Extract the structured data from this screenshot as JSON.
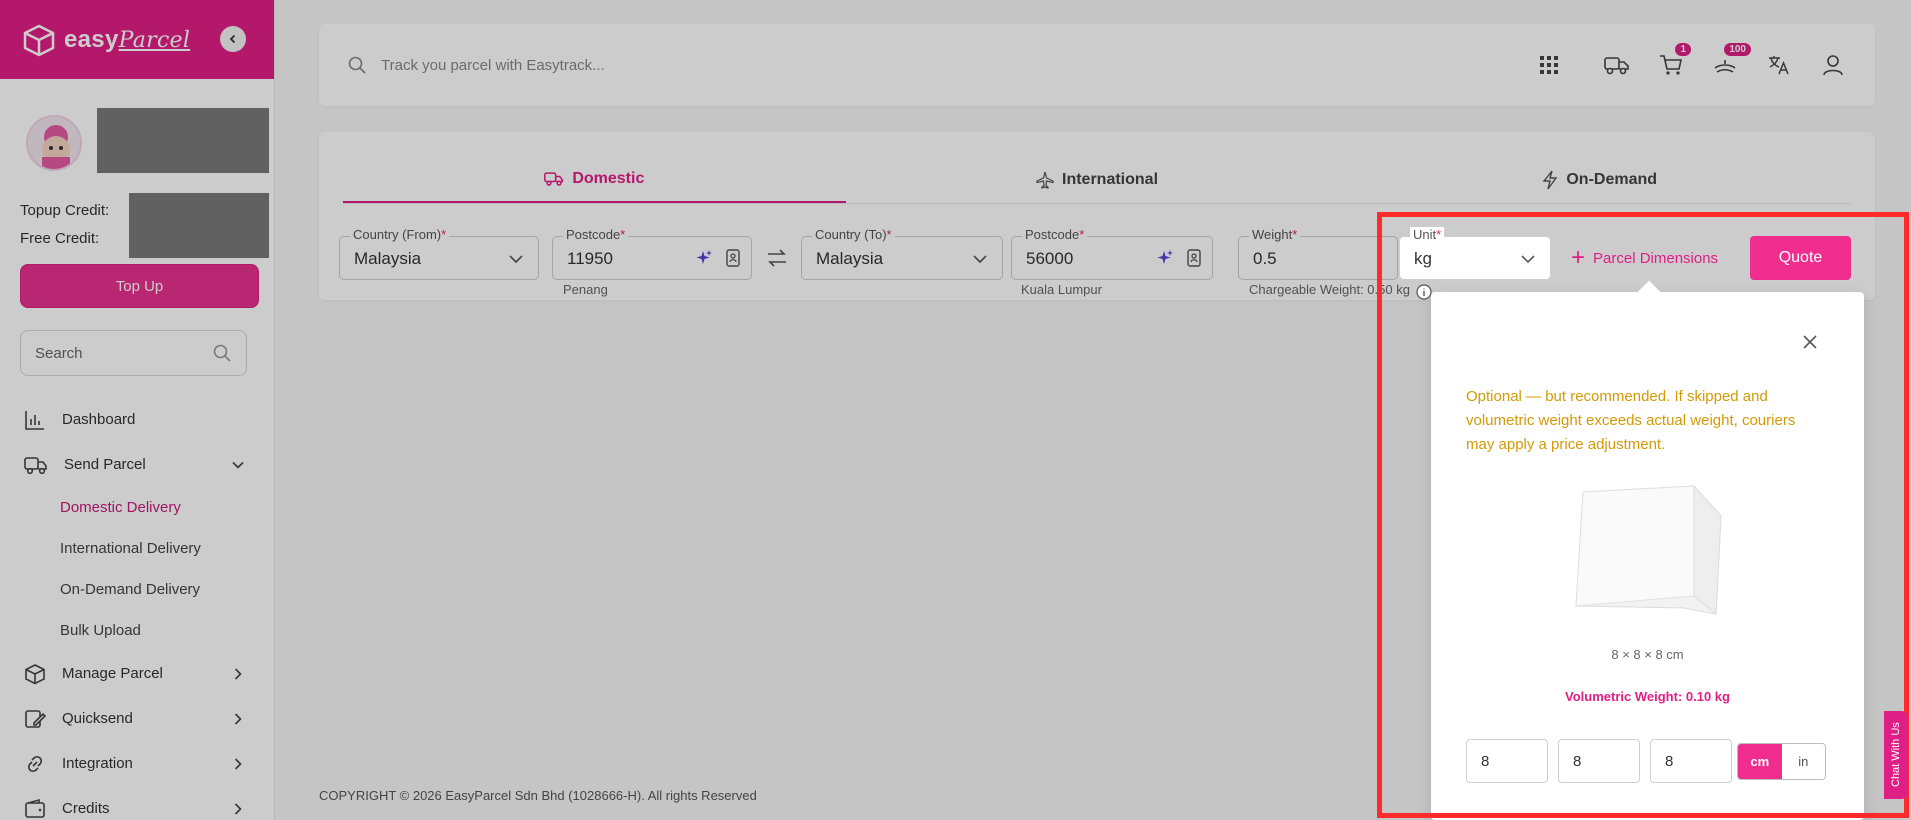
{
  "brand": {
    "name": "easy",
    "name_italic": "Parcel"
  },
  "profile": {
    "topup_credit_label": "Topup Credit:",
    "free_credit_label": "Free Credit:",
    "topup_button": "Top Up"
  },
  "sidebar": {
    "search_placeholder": "Search",
    "items": [
      {
        "label": "Dashboard",
        "icon": "chart-icon"
      },
      {
        "label": "Send Parcel",
        "icon": "truck-icon"
      },
      {
        "label": "Manage Parcel",
        "icon": "box-icon"
      },
      {
        "label": "Quicksend",
        "icon": "quicksend-icon"
      },
      {
        "label": "Integration",
        "icon": "link-icon"
      },
      {
        "label": "Credits",
        "icon": "wallet-icon"
      }
    ],
    "sub_items": [
      {
        "label": "Domestic Delivery",
        "active": true
      },
      {
        "label": "International Delivery",
        "active": false
      },
      {
        "label": "On-Demand Delivery",
        "active": false
      },
      {
        "label": "Bulk Upload",
        "active": false
      }
    ]
  },
  "topbar": {
    "search_placeholder": "Track you parcel with Easytrack...",
    "cart_count": "1",
    "notification_count": "100"
  },
  "tabs": [
    {
      "label": "Domestic",
      "active": true
    },
    {
      "label": "International",
      "active": false
    },
    {
      "label": "On-Demand",
      "active": false
    }
  ],
  "form": {
    "country_from_label": "Country (From)",
    "country_from": "Malaysia",
    "postcode_from_label": "Postcode",
    "postcode_from": "11950",
    "postcode_from_city": "Penang",
    "country_to_label": "Country (To)",
    "country_to": "Malaysia",
    "postcode_to_label": "Postcode",
    "postcode_to": "56000",
    "postcode_to_city": "Kuala Lumpur",
    "weight_label": "Weight",
    "weight": "0.5",
    "chargeable_weight": "Chargeable Weight: 0.50 kg",
    "unit_label": "Unit",
    "unit": "kg",
    "parcel_dimensions": "Parcel Dimensions",
    "quote_button": "Quote",
    "required_mark": "*"
  },
  "dimensions_popup": {
    "note": "Optional — but recommended. If skipped and volumetric weight exceeds actual weight, couriers may apply a price adjustment.",
    "cube_label": "8 × 8 × 8 cm",
    "volumetric_weight": "Volumetric Weight: 0.10 kg",
    "length": "8",
    "width": "8",
    "height": "8",
    "unit_cm": "cm",
    "unit_in": "in",
    "selected_unit": "cm"
  },
  "footer": {
    "copyright": "COPYRIGHT © 2026 EasyParcel Sdn Bhd (1028666-H). All rights Reserved"
  },
  "chat_tab": "Chat With Us",
  "colors": {
    "brand": "#e01f86",
    "warning": "#d49a06",
    "highlight": "#ff2a2a"
  }
}
